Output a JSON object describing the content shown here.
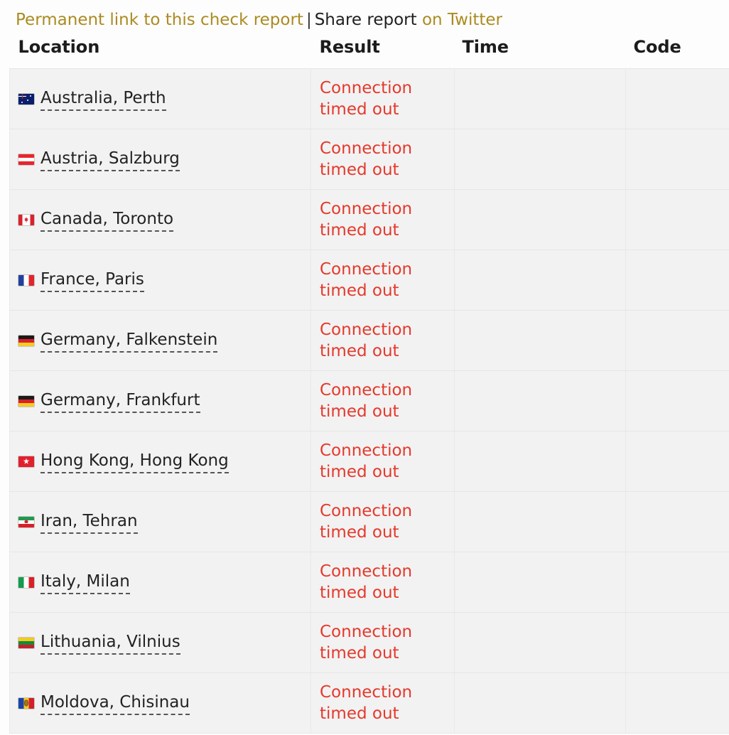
{
  "header": {
    "permalink_label": "Permanent link to this check report",
    "separator": "|",
    "share_label": "Share report",
    "twitter_label": "on Twitter"
  },
  "table": {
    "columns": [
      "Location",
      "Result",
      "Time",
      "Code"
    ],
    "rows": [
      {
        "flag": "flag-au",
        "flag_name": "flag-australia-icon",
        "location": "Australia, Perth",
        "result": "Connection timed out",
        "time": "",
        "code": ""
      },
      {
        "flag": "flag-at",
        "flag_name": "flag-austria-icon",
        "location": "Austria, Salzburg",
        "result": "Connection timed out",
        "time": "",
        "code": ""
      },
      {
        "flag": "flag-ca",
        "flag_name": "flag-canada-icon",
        "location": "Canada, Toronto",
        "result": "Connection timed out",
        "time": "",
        "code": ""
      },
      {
        "flag": "flag-fr",
        "flag_name": "flag-france-icon",
        "location": "France, Paris",
        "result": "Connection timed out",
        "time": "",
        "code": ""
      },
      {
        "flag": "flag-de",
        "flag_name": "flag-germany-icon",
        "location": "Germany, Falkenstein",
        "result": "Connection timed out",
        "time": "",
        "code": ""
      },
      {
        "flag": "flag-de",
        "flag_name": "flag-germany-icon",
        "location": "Germany, Frankfurt",
        "result": "Connection timed out",
        "time": "",
        "code": ""
      },
      {
        "flag": "flag-hk",
        "flag_name": "flag-hong-kong-icon",
        "location": "Hong Kong, Hong Kong",
        "result": "Connection timed out",
        "time": "",
        "code": ""
      },
      {
        "flag": "flag-ir",
        "flag_name": "flag-iran-icon",
        "location": "Iran, Tehran",
        "result": "Connection timed out",
        "time": "",
        "code": ""
      },
      {
        "flag": "flag-it",
        "flag_name": "flag-italy-icon",
        "location": "Italy, Milan",
        "result": "Connection timed out",
        "time": "",
        "code": ""
      },
      {
        "flag": "flag-lt",
        "flag_name": "flag-lithuania-icon",
        "location": "Lithuania, Vilnius",
        "result": "Connection timed out",
        "time": "",
        "code": ""
      },
      {
        "flag": "flag-md",
        "flag_name": "flag-moldova-icon",
        "location": "Moldova, Chisinau",
        "result": "Connection timed out",
        "time": "",
        "code": ""
      }
    ]
  },
  "colors": {
    "link_gold": "#ab8b21",
    "error_red": "#e5392c",
    "row_background": "#f2f2f2",
    "page_background": "#fdfdfd",
    "header_text": "#1c1c1c"
  }
}
